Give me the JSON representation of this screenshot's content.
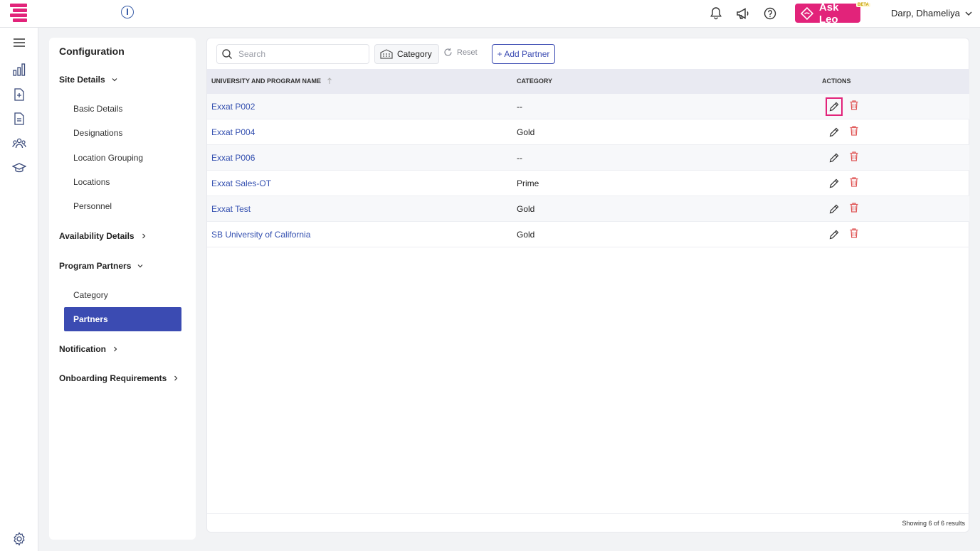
{
  "topbar": {
    "ask_leo": "Ask Leo",
    "beta": "BETA",
    "user_name": "Darp, Dhameliya",
    "brand_color": "#e2237a"
  },
  "config": {
    "title": "Configuration",
    "sections": {
      "site_details": "Site Details",
      "availability": "Availability Details",
      "program_partners": "Program Partners",
      "notification": "Notification",
      "onboarding": "Onboarding Requirements"
    },
    "site_items": [
      "Basic Details",
      "Designations",
      "Location Grouping",
      "Locations",
      "Personnel"
    ],
    "partner_items": [
      "Category",
      "Partners"
    ],
    "active_item": "Partners"
  },
  "toolbar": {
    "search_placeholder": "Search",
    "category_label": "Category",
    "reset_label": "Reset",
    "add_label": "+ Add Partner"
  },
  "table": {
    "headers": {
      "name": "UNIVERSITY AND PROGRAM NAME",
      "category": "CATEGORY",
      "actions": "ACTIONS"
    },
    "rows": [
      {
        "name": "Exxat P002",
        "category": "--"
      },
      {
        "name": "Exxat P004",
        "category": "Gold"
      },
      {
        "name": "Exxat P006",
        "category": "--"
      },
      {
        "name": "Exxat Sales-OT",
        "category": "Prime"
      },
      {
        "name": "Exxat Test",
        "category": "Gold"
      },
      {
        "name": "SB University of California",
        "category": "Gold"
      }
    ],
    "footer": "Showing 6 of 6 results"
  },
  "colors": {
    "accent": "#3b4bb2",
    "link": "#3450b0",
    "delete": "#e05a5a"
  }
}
